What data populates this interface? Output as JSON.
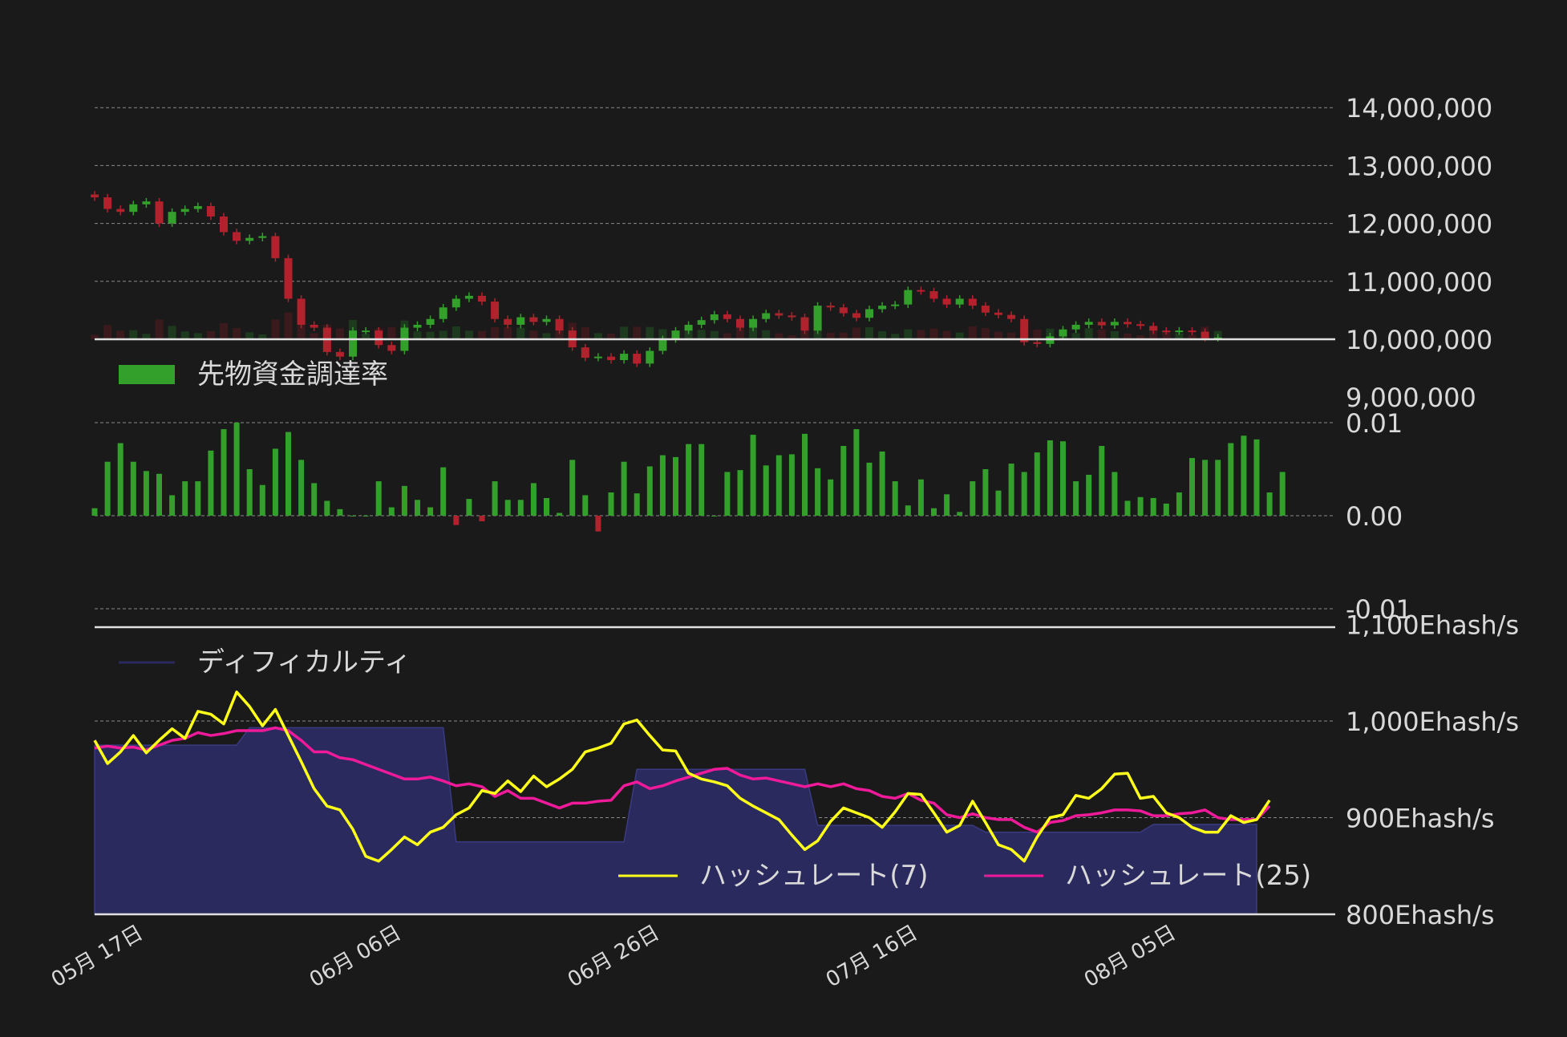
{
  "chart_data": [
    {
      "type": "candlestick",
      "ylim": [
        9000000,
        14000000
      ],
      "ytick_labels": [
        "9,000,000",
        "10,000,000",
        "11,000,000",
        "12,000,000",
        "13,000,000",
        "14,000,000"
      ],
      "ytick_values": [
        9000000,
        10000000,
        11000000,
        12000000,
        13000000,
        14000000
      ],
      "grid": true,
      "up_color": "#33a02c",
      "down_color": "#b2222d",
      "close": [
        12450000,
        12250000,
        12200000,
        12330000,
        12380000,
        12000000,
        12200000,
        12250000,
        12300000,
        12120000,
        11850000,
        11700000,
        11750000,
        11780000,
        11400000,
        10700000,
        10250000,
        10200000,
        9780000,
        9700000,
        10150000,
        10150000,
        9900000,
        9800000,
        10200000,
        10250000,
        10350000,
        10550000,
        10700000,
        10750000,
        10650000,
        10350000,
        10250000,
        10380000,
        10300000,
        10350000,
        10150000,
        9860000,
        9680000,
        9700000,
        9640000,
        9750000,
        9580000,
        9800000,
        10000000,
        10150000,
        10250000,
        10330000,
        10430000,
        10350000,
        10200000,
        10350000,
        10450000,
        10410000,
        10380000,
        10150000,
        10580000,
        10550000,
        10450000,
        10370000,
        10520000,
        10580000,
        10600000,
        10850000,
        10830000,
        10700000,
        10600000,
        10700000,
        10580000,
        10460000,
        10420000,
        10350000,
        9950000,
        9920000,
        10050000,
        10170000,
        10250000,
        10300000,
        10240000,
        10300000,
        10260000,
        10230000,
        10150000,
        10140000,
        10150000,
        10130000,
        10020000,
        10030000
      ],
      "volume_bars": true,
      "volume_colors": [
        "#3a1a1c",
        "#1e3a1e"
      ]
    },
    {
      "type": "bar",
      "legend": "先物資金調達率",
      "ylim": [
        -0.01,
        0.01
      ],
      "ytick_labels": [
        "-0.01",
        "0.00",
        "0.01"
      ],
      "ytick_values": [
        -0.01,
        0.0,
        0.01
      ],
      "grid": true,
      "color": "#33a02c",
      "values": [
        0.0008,
        0.0058,
        0.0078,
        0.0058,
        0.0048,
        0.0045,
        0.0022,
        0.0037,
        0.0037,
        0.007,
        0.0093,
        0.01,
        0.005,
        0.0033,
        0.0072,
        0.009,
        0.006,
        0.0035,
        0.0016,
        0.0007,
        0.0,
        0.0,
        0.0037,
        0.0009,
        0.0032,
        0.0017,
        0.0009,
        0.0052,
        -0.001,
        0.0018,
        -0.0006,
        0.0037,
        0.0017,
        0.0017,
        0.0035,
        0.0019,
        0.0003,
        0.006,
        0.0022,
        -0.0017,
        0.0025,
        0.0058,
        0.0024,
        0.0053,
        0.0065,
        0.0063,
        0.0077,
        0.0077,
        0.0,
        0.0047,
        0.0049,
        0.0087,
        0.0054,
        0.0065,
        0.0066,
        0.0088,
        0.0051,
        0.0039,
        0.0075,
        0.0093,
        0.0057,
        0.0069,
        0.0037,
        0.0011,
        0.0039,
        0.0008,
        0.0023,
        0.0004,
        0.0037,
        0.005,
        0.0027,
        0.0056,
        0.0047,
        0.0068,
        0.0081,
        0.008,
        0.0037,
        0.0044,
        0.0075,
        0.0047,
        0.0016,
        0.002,
        0.0019,
        0.0013,
        0.0025,
        0.0062,
        0.006,
        0.006,
        0.0078,
        0.0086,
        0.0082,
        0.0025,
        0.0047
      ]
    },
    {
      "type": "area+line",
      "ylim": [
        800,
        1100
      ],
      "ytick_labels": [
        "800Ehash/s",
        "900Ehash/s",
        "1,000Ehash/s",
        "1,100Ehash/s"
      ],
      "ytick_values": [
        800,
        900,
        1000,
        1100
      ],
      "grid": true,
      "series": [
        {
          "name": "ディフィカルティ",
          "kind": "area",
          "color": "#2a2a5e",
          "line_color": "#3a3a80",
          "values": [
            975,
            975,
            975,
            975,
            975,
            975,
            975,
            975,
            975,
            975,
            975,
            975,
            993,
            993,
            993,
            993,
            993,
            993,
            993,
            993,
            993,
            993,
            993,
            993,
            993,
            993,
            993,
            993,
            875,
            875,
            875,
            875,
            875,
            875,
            875,
            875,
            875,
            875,
            875,
            875,
            875,
            875,
            950,
            950,
            950,
            950,
            950,
            950,
            950,
            950,
            950,
            950,
            950,
            950,
            950,
            950,
            892,
            892,
            892,
            892,
            892,
            892,
            892,
            892,
            892,
            892,
            892,
            892,
            892,
            885,
            885,
            885,
            885,
            885,
            885,
            885,
            885,
            885,
            885,
            885,
            885,
            885,
            893,
            893,
            893,
            893,
            893,
            893,
            893,
            893,
            893
          ]
        },
        {
          "name": "ハッシュレート(7)",
          "kind": "line",
          "color": "#ffff1a",
          "values": [
            980,
            956,
            968,
            985,
            967,
            980,
            992,
            982,
            1010,
            1007,
            997,
            1030,
            1015,
            995,
            1012,
            985,
            958,
            930,
            912,
            908,
            888,
            860,
            855,
            867,
            880,
            872,
            885,
            890,
            903,
            910,
            928,
            925,
            938,
            927,
            943,
            932,
            940,
            950,
            968,
            972,
            977,
            997,
            1001,
            985,
            970,
            969,
            946,
            940,
            937,
            933,
            920,
            912,
            905,
            898,
            882,
            867,
            876,
            896,
            910,
            905,
            900,
            890,
            906,
            925,
            924,
            905,
            885,
            892,
            917,
            895,
            872,
            867,
            855,
            880,
            900,
            903,
            923,
            920,
            930,
            945,
            946,
            920,
            922,
            905,
            900,
            890,
            885,
            885,
            902,
            895,
            898,
            918
          ]
        },
        {
          "name": "ハッシュレート(25)",
          "kind": "line",
          "color": "#ee1a9a",
          "values": [
            972,
            974,
            972,
            973,
            970,
            975,
            980,
            982,
            988,
            985,
            987,
            990,
            990,
            990,
            993,
            990,
            980,
            968,
            968,
            962,
            960,
            955,
            950,
            945,
            940,
            940,
            942,
            938,
            933,
            935,
            932,
            922,
            928,
            920,
            920,
            915,
            910,
            915,
            915,
            917,
            918,
            933,
            937,
            930,
            933,
            938,
            942,
            946,
            950,
            951,
            944,
            940,
            941,
            938,
            935,
            932,
            935,
            932,
            935,
            930,
            928,
            922,
            920,
            925,
            918,
            915,
            903,
            900,
            904,
            900,
            898,
            898,
            890,
            885,
            895,
            897,
            902,
            903,
            905,
            908,
            908,
            907,
            902,
            902,
            904,
            905,
            908,
            900,
            898,
            898,
            898,
            912
          ]
        }
      ]
    }
  ],
  "x_tick_labels": [
    "05月 17日",
    "06月 06日",
    "06月 26日",
    "07月 16日",
    "08月 05日"
  ]
}
